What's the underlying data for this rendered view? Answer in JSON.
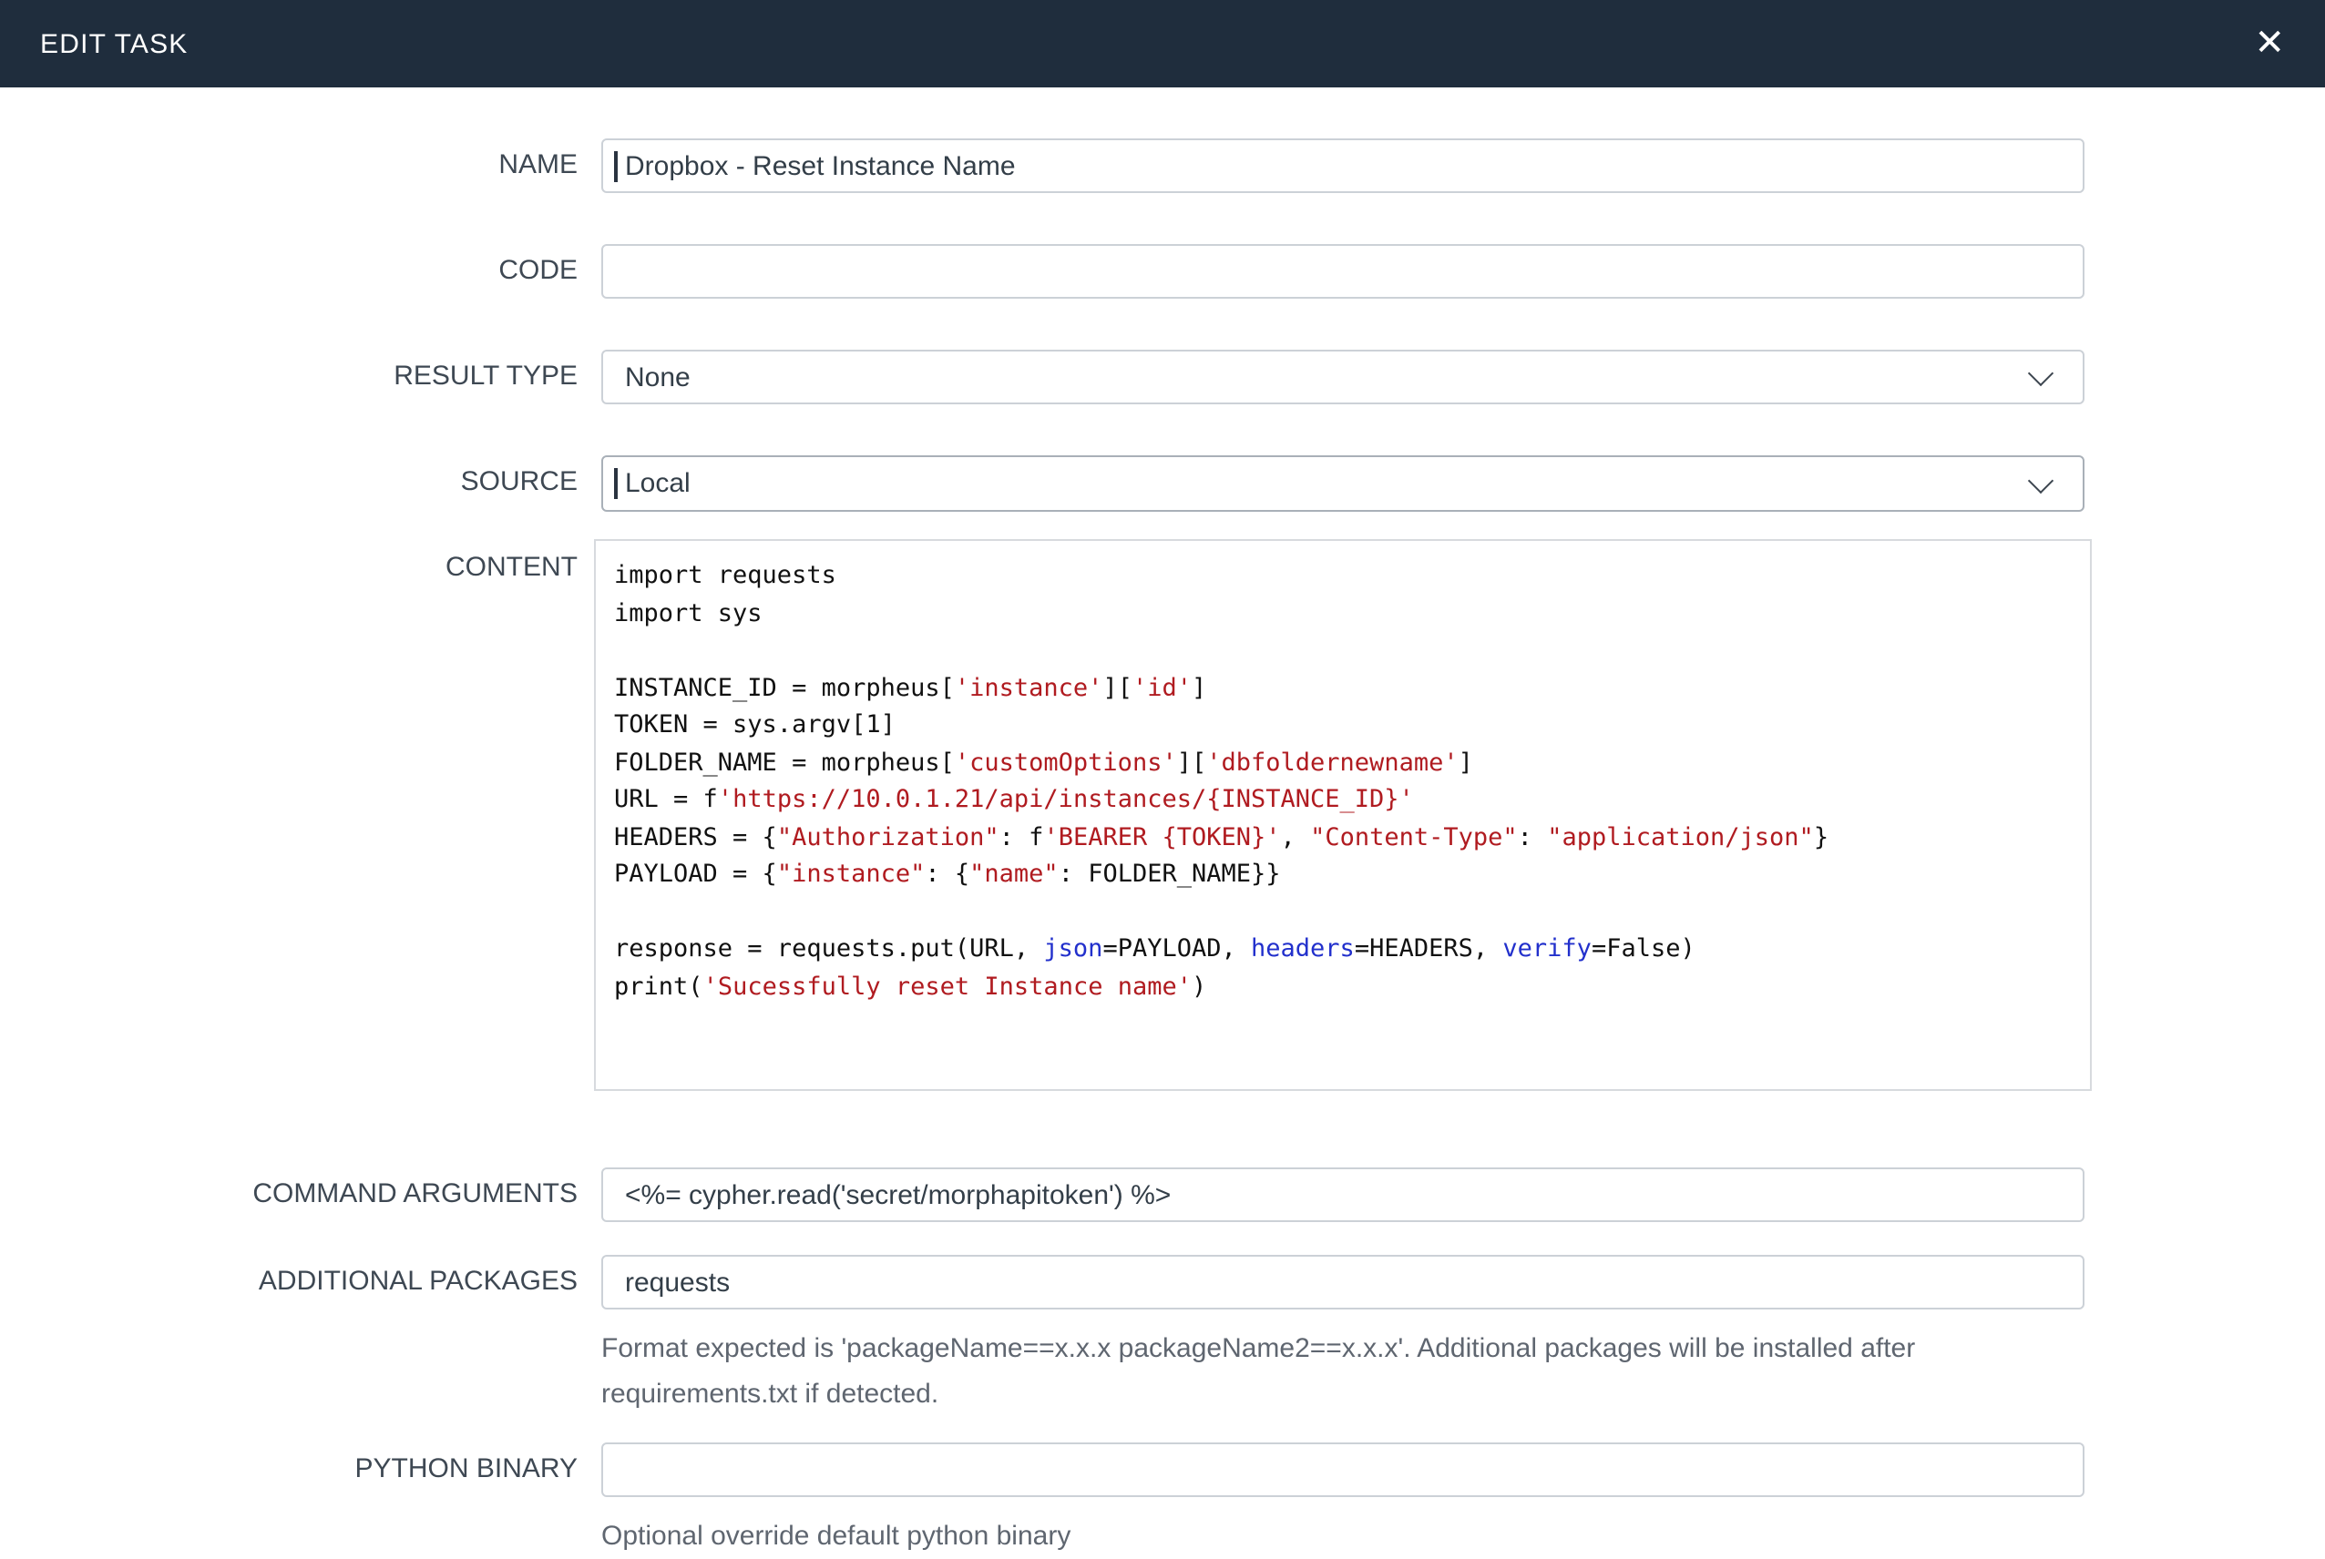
{
  "modal": {
    "title": "EDIT TASK",
    "close_icon": "✕"
  },
  "colors": {
    "header_bg": "#1f2d3d",
    "code_string": "#b01b20",
    "code_keyword": "#2230cc",
    "input_border": "#ccd1d7"
  },
  "form": {
    "name": {
      "label": "NAME",
      "value": "Dropbox - Reset Instance Name",
      "placeholder": ""
    },
    "code": {
      "label": "CODE",
      "value": "",
      "placeholder": ""
    },
    "result_type": {
      "label": "RESULT TYPE",
      "value": "None"
    },
    "source": {
      "label": "SOURCE",
      "value": "Local"
    },
    "content": {
      "label": "CONTENT",
      "lines": [
        [
          {
            "t": "import requests"
          }
        ],
        [
          {
            "t": "import sys"
          }
        ],
        [],
        [
          {
            "t": "INSTANCE_ID = morpheus["
          },
          {
            "t": "'instance'",
            "c": "str"
          },
          {
            "t": "]["
          },
          {
            "t": "'id'",
            "c": "str"
          },
          {
            "t": "]"
          }
        ],
        [
          {
            "t": "TOKEN = sys.argv[1]"
          }
        ],
        [
          {
            "t": "FOLDER_NAME = morpheus["
          },
          {
            "t": "'customOptions'",
            "c": "str"
          },
          {
            "t": "]["
          },
          {
            "t": "'dbfoldernewname'",
            "c": "str"
          },
          {
            "t": "]"
          }
        ],
        [
          {
            "t": "URL = f"
          },
          {
            "t": "'https://10.0.1.21/api/instances/{INSTANCE_ID}'",
            "c": "str"
          }
        ],
        [
          {
            "t": "HEADERS = {"
          },
          {
            "t": "\"Authorization\"",
            "c": "str"
          },
          {
            "t": ": f"
          },
          {
            "t": "'BEARER {TOKEN}'",
            "c": "str"
          },
          {
            "t": ", "
          },
          {
            "t": "\"Content-Type\"",
            "c": "str"
          },
          {
            "t": ": "
          },
          {
            "t": "\"application/json\"",
            "c": "str"
          },
          {
            "t": "}"
          }
        ],
        [
          {
            "t": "PAYLOAD = {"
          },
          {
            "t": "\"instance\"",
            "c": "str"
          },
          {
            "t": ": {"
          },
          {
            "t": "\"name\"",
            "c": "str"
          },
          {
            "t": ": FOLDER_NAME}}"
          }
        ],
        [],
        [
          {
            "t": "response = requests.put(URL, "
          },
          {
            "t": "json",
            "c": "kw"
          },
          {
            "t": "=PAYLOAD, "
          },
          {
            "t": "headers",
            "c": "kw"
          },
          {
            "t": "=HEADERS, "
          },
          {
            "t": "verify",
            "c": "kw"
          },
          {
            "t": "=False)"
          }
        ],
        [
          {
            "t": "print("
          },
          {
            "t": "'Sucessfully reset Instance name'",
            "c": "str"
          },
          {
            "t": ")"
          }
        ]
      ]
    },
    "command_arguments": {
      "label": "COMMAND ARGUMENTS",
      "value": "<%= cypher.read('secret/morphapitoken') %>",
      "placeholder": ""
    },
    "additional_packages": {
      "label": "ADDITIONAL PACKAGES",
      "value": "requests",
      "placeholder": "",
      "help": "Format expected is 'packageName==x.x.x packageName2==x.x.x'. Additional packages will be installed after requirements.txt if detected."
    },
    "python_binary": {
      "label": "PYTHON BINARY",
      "value": "",
      "placeholder": "",
      "help": "Optional override default python binary"
    }
  }
}
